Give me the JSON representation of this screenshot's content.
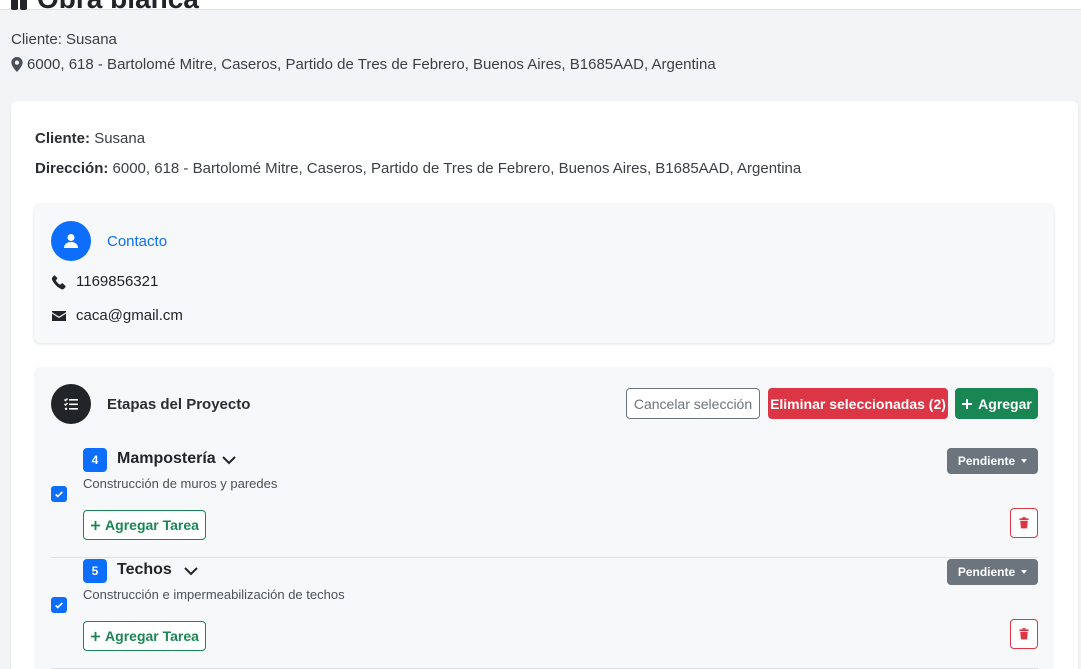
{
  "header": {
    "title": "Obra blanca",
    "client_line": "Cliente: Susana",
    "address_line": "6000, 618 - Bartolomé Mitre, Caseros, Partido de Tres de Febrero, Buenos Aires, B1685AAD, Argentina"
  },
  "info": {
    "client_label": "Cliente:",
    "client_value": "Susana",
    "address_label": "Dirección:",
    "address_value": "6000, 618 - Bartolomé Mitre, Caseros, Partido de Tres de Febrero, Buenos Aires, B1685AAD, Argentina"
  },
  "contact": {
    "title": "Contacto",
    "phone": "1169856321",
    "email": "caca@gmail.cm"
  },
  "stages_section": {
    "title": "Etapas del Proyecto",
    "cancel_label": "Cancelar selección",
    "delete_selected_label": "Eliminar seleccionadas (2)",
    "add_label": "Agregar",
    "stages": [
      {
        "number": "4",
        "name": "Mampostería",
        "description": "Construcción de muros y paredes",
        "status": "Pendiente",
        "checked": true,
        "add_task_label": "Agregar Tarea"
      },
      {
        "number": "5",
        "name": "Techos",
        "description": "Construcción e impermeabilización de techos",
        "status": "Pendiente",
        "checked": true,
        "add_task_label": "Agregar Tarea"
      }
    ]
  },
  "colors": {
    "primary": "#0d6efd",
    "danger": "#dc3545",
    "success": "#198754",
    "secondary": "#6c757d",
    "dark": "#212529"
  }
}
